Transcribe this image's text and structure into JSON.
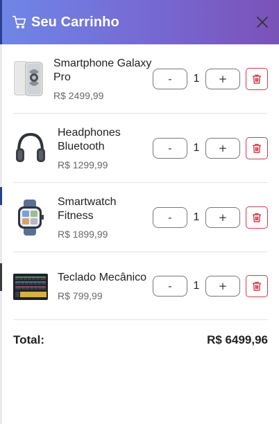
{
  "header": {
    "title": "Seu Carrinho"
  },
  "items": [
    {
      "name": "Smartphone Galaxy Pro",
      "price": "R$ 2499,99",
      "qty": "1",
      "minus": "-",
      "plus": "+"
    },
    {
      "name": "Headphones Bluetooth",
      "price": "R$ 1299,99",
      "qty": "1",
      "minus": "-",
      "plus": "+"
    },
    {
      "name": "Smartwatch Fitness",
      "price": "R$ 1899,99",
      "qty": "1",
      "minus": "-",
      "plus": "+"
    },
    {
      "name": "Teclado Mecânico",
      "price": "R$ 799,99",
      "qty": "1",
      "minus": "-",
      "plus": "+"
    }
  ],
  "total": {
    "label": "Total:",
    "value": "R$ 6499,96"
  },
  "colors": {
    "header_start": "#6f86e6",
    "header_end": "#7a52b8",
    "delete": "#d23a4a"
  }
}
